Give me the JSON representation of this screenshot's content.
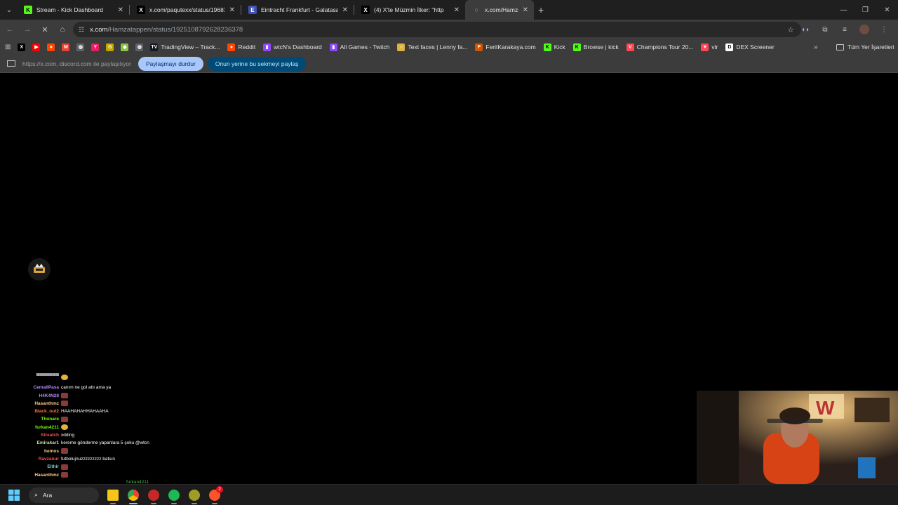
{
  "browser": {
    "tabs": [
      {
        "title": "Stream - Kick Dashboard",
        "icon": "kick-icon",
        "icon_color": "#53fc18",
        "glyph": "K"
      },
      {
        "title": "x.com/paqutexx/status/196878",
        "icon": "x-icon",
        "icon_color": "#000000",
        "glyph": "X"
      },
      {
        "title": "Eintracht Frankfurt - Galatasara",
        "icon": "site-icon",
        "icon_color": "#3f51b5",
        "glyph": "E"
      },
      {
        "title": "(4) X'te Müzmin İlker: \"http",
        "icon": "x-icon",
        "icon_color": "#000000",
        "glyph": "X"
      },
      {
        "title": "x.com/Hamzatap",
        "icon": "loading-icon",
        "icon_color": "#3c3c3c",
        "glyph": "◌",
        "active": true
      }
    ],
    "new_tab_glyph": "+",
    "window_controls": [
      "—",
      "❐",
      "✕"
    ],
    "url": {
      "host": "x.com",
      "path": "/Hamzatappen/status/1925108792628236378"
    },
    "bookmarks": [
      {
        "label": "",
        "icon": "x-icon",
        "color": "#000000",
        "glyph": "X"
      },
      {
        "label": "",
        "icon": "youtube-icon",
        "color": "#ff0000",
        "glyph": "▶"
      },
      {
        "label": "",
        "icon": "reddit-icon",
        "color": "#ff4500",
        "glyph": "●"
      },
      {
        "label": "",
        "icon": "gmail-icon",
        "color": "#ea4335",
        "glyph": "M"
      },
      {
        "label": "",
        "icon": "globe-icon",
        "color": "#5f6368",
        "glyph": "◍"
      },
      {
        "label": "",
        "icon": "y-icon",
        "color": "#e91e63",
        "glyph": "Y"
      },
      {
        "label": "",
        "icon": "g-icon",
        "color": "#c6a700",
        "glyph": "G"
      },
      {
        "label": "",
        "icon": "android-icon",
        "color": "#8bc34a",
        "glyph": "◆"
      },
      {
        "label": "",
        "icon": "globe-icon",
        "color": "#5f6368",
        "glyph": "◍"
      },
      {
        "label": "TradingView – Track...",
        "icon": "tradingview-icon",
        "color": "#131722",
        "glyph": "TV"
      },
      {
        "label": "Reddit",
        "icon": "reddit-icon",
        "color": "#ff4500",
        "glyph": "●"
      },
      {
        "label": "wtcN's Dashboard",
        "icon": "twitch-icon",
        "color": "#9146ff",
        "glyph": "▮"
      },
      {
        "label": "All Games - Twitch",
        "icon": "twitch-icon",
        "color": "#9146ff",
        "glyph": "▮"
      },
      {
        "label": "Text faces | Lenny fa...",
        "icon": "face-icon",
        "color": "#e0b33a",
        "glyph": "☺"
      },
      {
        "label": "FeritKarakaya.com",
        "icon": "site-icon",
        "color": "#d35400",
        "glyph": "F"
      },
      {
        "label": "Kick",
        "icon": "kick-icon",
        "color": "#53fc18",
        "glyph": "K"
      },
      {
        "label": "Browse | kick",
        "icon": "kick-icon",
        "color": "#53fc18",
        "glyph": "K"
      },
      {
        "label": "Champions Tour 20...",
        "icon": "valorant-icon",
        "color": "#ff4655",
        "glyph": "V"
      },
      {
        "label": "vlr",
        "icon": "vlr-icon",
        "color": "#ff4655",
        "glyph": "▼"
      },
      {
        "label": "DEX Screener",
        "icon": "dexscreener-icon",
        "color": "#ffffff",
        "glyph": "D"
      }
    ],
    "bookmarks_more": "»",
    "all_bookmarks": "Tüm Yer İşaretleri"
  },
  "share_bar": {
    "text": "https://x.com, discord.com ile paylaşılıyor",
    "stop_label": "Paylaşmayı durdur",
    "share_instead_label": "Onun yerine bu sekmeyi paylaş"
  },
  "chat": {
    "messages": [
      {
        "user": "CemallPasa",
        "color": "#b388ff",
        "text": "canım ne gol attı ama ya",
        "emote": ""
      },
      {
        "user": "H4K4N28",
        "color": "#b388ff",
        "text": "",
        "emote": "red"
      },
      {
        "user": "Hasanthmz",
        "color": "#ffcc80",
        "text": "",
        "emote": "red"
      },
      {
        "user": "Black_out2",
        "color": "#ff7043",
        "text": "HAAHAHAHHAHAAHA",
        "emote": ""
      },
      {
        "user": "Thonare",
        "color": "#76ff03",
        "text": "",
        "emote": "red"
      },
      {
        "user": "furkan4211",
        "color": "#76ff03",
        "text": "",
        "emote": "yellow"
      },
      {
        "user": "Streatch",
        "color": "#ef5350",
        "text": "xdding",
        "emote": ""
      },
      {
        "user": "Emirakar1",
        "color": "#c5e1a5",
        "text": "kereme gönderme yapanlara 5 şoku @wtcn",
        "emote": ""
      },
      {
        "user": "hemos",
        "color": "#ffcc80",
        "text": "",
        "emote": "red"
      },
      {
        "user": "Ravzanur",
        "color": "#ef5350",
        "text": "futbolujnuzzzzzzzzz batsın",
        "emote": ""
      },
      {
        "user": "Elthir",
        "color": "#80cbc4",
        "text": "",
        "emote": "red"
      },
      {
        "user": "Hasanthmz",
        "color": "#ffcc80",
        "text": "",
        "emote": "red"
      }
    ],
    "floating_user": "furkan4211"
  },
  "taskbar": {
    "search_label": "Ara",
    "apps": [
      {
        "icon": "file-explorer-icon",
        "color": "#f5c518"
      },
      {
        "icon": "chrome-icon",
        "color": "#4285f4",
        "active": true
      },
      {
        "icon": "media-app-icon",
        "color": "#c62828"
      },
      {
        "icon": "spotify-icon",
        "color": "#1db954"
      },
      {
        "icon": "app-icon",
        "color": "#9e9d24"
      },
      {
        "icon": "brave-icon",
        "color": "#fb542b",
        "badge": "2"
      }
    ]
  }
}
